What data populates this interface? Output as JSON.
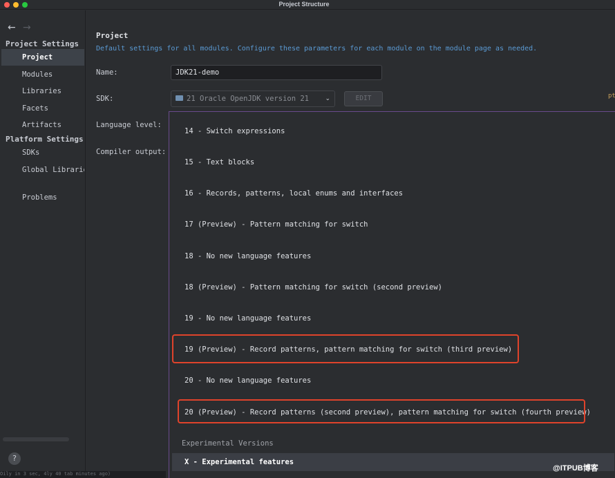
{
  "window": {
    "title": "Project Structure"
  },
  "nav": {
    "back": "←",
    "forward": "→"
  },
  "sidebar": {
    "project_settings_header": "Project Settings",
    "platform_settings_header": "Platform Settings",
    "items": [
      {
        "label": "Project",
        "selected": true
      },
      {
        "label": "Modules"
      },
      {
        "label": "Libraries"
      },
      {
        "label": "Facets"
      },
      {
        "label": "Artifacts"
      }
    ],
    "platform_items": [
      {
        "label": "SDKs"
      },
      {
        "label": "Global Libraries"
      }
    ],
    "problems_label": "Problems",
    "help_glyph": "?"
  },
  "main": {
    "title": "Project",
    "description": "Default settings for all modules. Configure these parameters for each module on the module page as needed.",
    "name_label": "Name:",
    "name_value": "JDK21-demo",
    "sdk_label": "SDK:",
    "sdk_value": "21 Oracle OpenJDK version 21",
    "edit_label": "EDIT",
    "language_level_label": "Language level:",
    "compiler_output_label": "Compiler output:"
  },
  "language_levels": {
    "options": [
      "14 - Switch expressions",
      "15 - Text blocks",
      "16 - Records, patterns, local enums and interfaces",
      "17 (Preview) - Pattern matching for switch",
      "18 - No new language features",
      "18 (Preview) - Pattern matching for switch (second preview)",
      "19 - No new language features",
      "19 (Preview) - Record patterns, pattern matching for switch (third preview)",
      "20 - No new language features",
      "20 (Preview) - Record patterns (second preview), pattern matching for switch (fourth preview)"
    ],
    "experimental_header": "Experimental Versions",
    "experimental_option": "X - Experimental features"
  },
  "overlay": {
    "watermark": "@ITPUB博客",
    "edge_fragment": "pt",
    "bottom_fragment": "Oily in 3 sec, 4ly 40 tab minutes ago)"
  },
  "colors": {
    "background": "#2b2d30",
    "highlight_border": "#e0432b",
    "description_text": "#5b9bd5",
    "popup_border": "#6a4a8c"
  },
  "icons": [
    "back-arrow-icon",
    "forward-arrow-icon",
    "folder-icon",
    "chevron-down-icon",
    "help-icon"
  ]
}
